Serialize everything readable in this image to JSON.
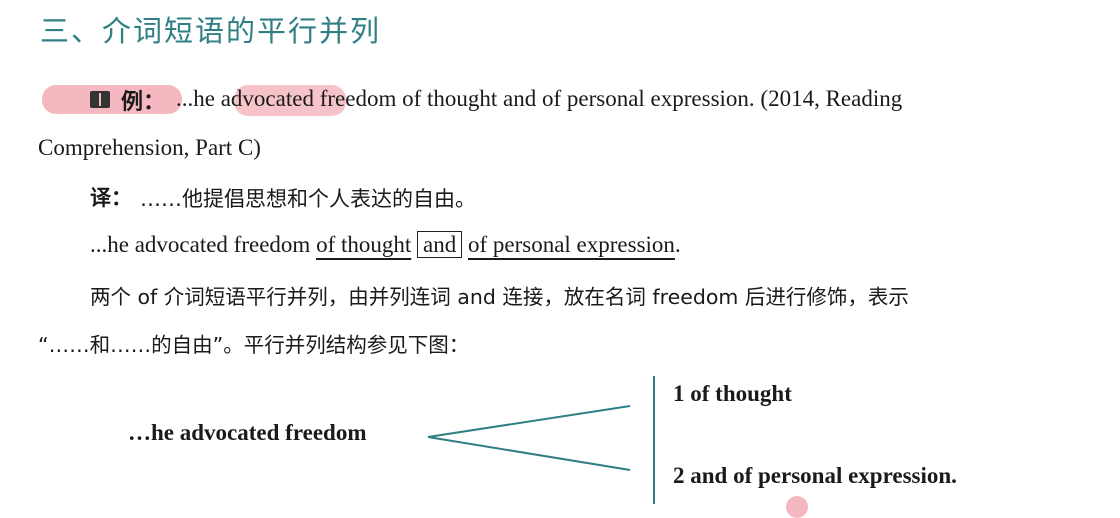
{
  "heading": "三、介词短语的平行并列",
  "example": {
    "label": "例：",
    "before": "...he ",
    "highlight": "advocated",
    "after": " freedom of thought and of personal expression. (2014, Reading",
    "line2": "Comprehension, Part C)"
  },
  "translation": {
    "label": "译：",
    "text": "……他提倡思想和个人表达的自由。"
  },
  "analysis": {
    "prefix": "...he advocated freedom ",
    "part1": "of thought",
    "conj": "and",
    "part2": "of personal expression",
    "suffix": "."
  },
  "explanation": {
    "line1": "两个 of 介词短语平行并列，由并列连词 and 连接，放在名词 freedom 后进行修饰，表示",
    "line2": "“……和……的自由”。平行并列结构参见下图："
  },
  "diagram": {
    "stem": "…he advocated freedom",
    "branch1": "1 of thought",
    "branch2": "2 and of personal expression."
  },
  "colors": {
    "heading": "#2f7f83",
    "highlight": "#f5b8c0",
    "diagram_line": "#2f7f83"
  },
  "icons": {
    "example_icon": "book-icon"
  }
}
